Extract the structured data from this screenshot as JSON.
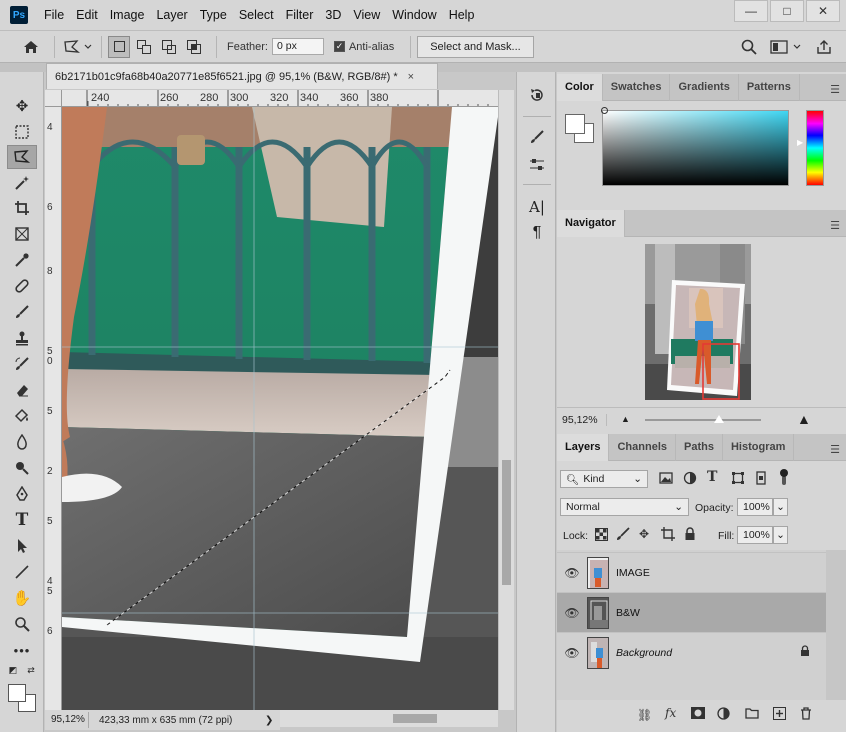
{
  "app": {
    "logo": "Ps",
    "menus": [
      "File",
      "Edit",
      "Image",
      "Layer",
      "Type",
      "Select",
      "Filter",
      "3D",
      "View",
      "Window",
      "Help"
    ],
    "window_controls": [
      "—",
      "□",
      "✕"
    ]
  },
  "options_bar": {
    "feather_label": "Feather:",
    "feather_value": "0 px",
    "antialias_label": "Anti-alias",
    "antialias_checked": true,
    "select_mask_label": "Select and Mask..."
  },
  "document": {
    "tab_title": "6b2171b01c9fa68b40a20771e85f6521.jpg @ 95,1% (B&W, RGB/8#) *",
    "close_glyph": "×",
    "ruler_top": [
      "240",
      "260",
      "280",
      "300",
      "320",
      "340",
      "360",
      "380"
    ],
    "ruler_left": [
      "4",
      "6",
      "8",
      "5",
      "0",
      "5",
      "2",
      "5",
      "4",
      "5",
      "6"
    ],
    "zoom": "95,12%",
    "size": "423,33 mm x 635 mm (72 ppi)",
    "status_arrow": "❯"
  },
  "panels": {
    "color_tabs": [
      "Color",
      "Swatches",
      "Gradients",
      "Patterns"
    ],
    "navigator_title": "Navigator",
    "navigator_zoom": "95,12%",
    "layers_tabs": [
      "Layers",
      "Channels",
      "Paths",
      "Histogram"
    ],
    "kind_label": "Kind",
    "blend_mode": "Normal",
    "opacity_label": "Opacity:",
    "opacity_value": "100%",
    "lock_label": "Lock:",
    "fill_label": "Fill:",
    "fill_value": "100%",
    "layers": [
      {
        "name": "IMAGE",
        "italic": false,
        "selected": false,
        "locked": false
      },
      {
        "name": "B&W",
        "italic": false,
        "selected": true,
        "locked": false
      },
      {
        "name": "Background",
        "italic": true,
        "selected": false,
        "locked": true
      }
    ]
  },
  "colors": {
    "accent_selection": "#e53935",
    "photoshop_blue": "#31a8ff"
  }
}
